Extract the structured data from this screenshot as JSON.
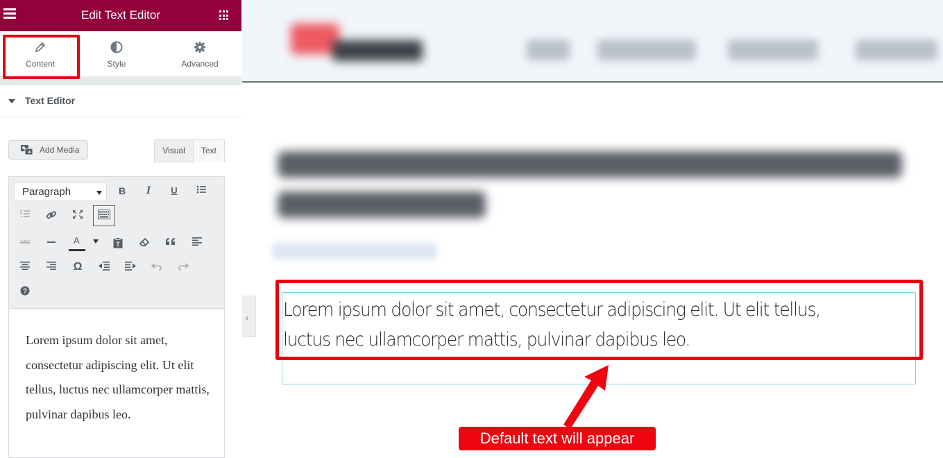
{
  "panel": {
    "header": {
      "title": "Edit Text Editor",
      "menu_icon": "hamburger-icon",
      "grid_icon": "widgets-grid-icon",
      "background_color": "#93003c"
    },
    "tabs": [
      {
        "label": "Content",
        "icon": "pencil-icon",
        "highlighted": true
      },
      {
        "label": "Style",
        "icon": "contrast-circle-icon"
      },
      {
        "label": "Advanced",
        "icon": "gear-icon"
      }
    ],
    "section": {
      "title": "Text Editor",
      "add_media_label": "Add Media",
      "mode_tabs": {
        "visual": "Visual",
        "text": "Text"
      },
      "format_select": "Paragraph",
      "toolbar_buttons": [
        "bold",
        "italic",
        "underline",
        "bulleted-list",
        "numbered-list",
        "link",
        "fullscreen",
        "toolbar-toggle",
        "strikethrough",
        "horizontal-line",
        "text-color",
        "paste-as-text",
        "clear-formatting",
        "blockquote",
        "align-left",
        "align-center",
        "align-right",
        "special-character",
        "outdent",
        "indent",
        "undo",
        "redo",
        "help"
      ],
      "editor_content": "Lorem ipsum dolor sit amet, consectetur adipiscing elit. Ut elit tellus, luctus nec ullamcorper mattis, pulvinar dapibus leo."
    }
  },
  "preview": {
    "text_widget_content": "Lorem ipsum dolor sit amet, consectetur adipiscing elit. Ut elit tellus, luctus nec ullamcorper mattis, pulvinar dapibus leo.",
    "annotation_label": "Default text will appear",
    "annotation_color": "#ee0511"
  }
}
